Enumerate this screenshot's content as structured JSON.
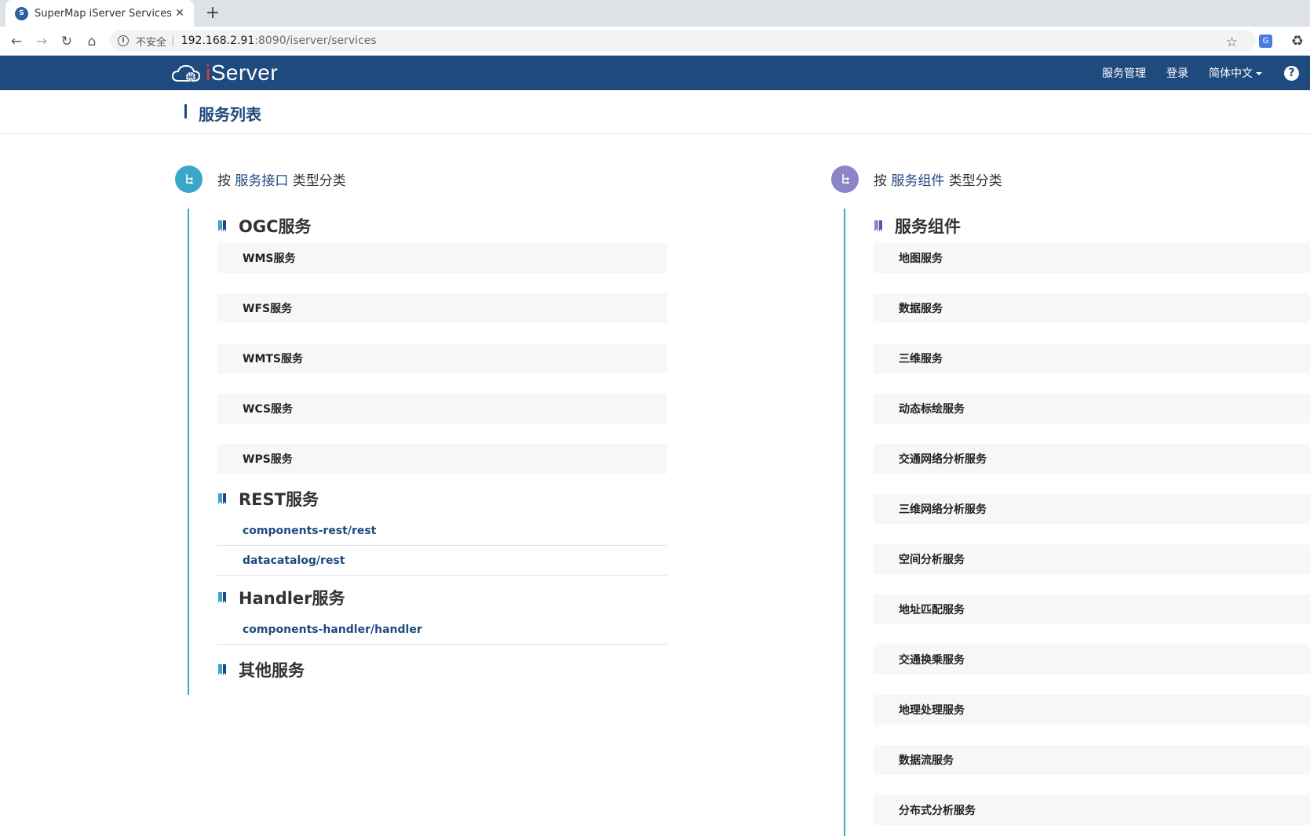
{
  "browser": {
    "tab_title": "SuperMap iServer Services",
    "close_glyph": "✕",
    "new_tab_glyph": "+",
    "insecure_label": "不安全",
    "url_host": "192.168.2.91",
    "url_rest": ":8090/iserver/services"
  },
  "header": {
    "logo_prefix": "i",
    "logo_rest": "Server",
    "nav": {
      "service_manage": "服务管理",
      "login": "登录",
      "language": "简体中文"
    },
    "help": "?"
  },
  "page_title": "服务列表",
  "left_column": {
    "heading_prefix": "按 ",
    "heading_accent": "服务接口",
    "heading_suffix": " 类型分类",
    "groups": [
      {
        "title": "OGC服务",
        "items": [
          "WMS服务",
          "WFS服务",
          "WMTS服务",
          "WCS服务",
          "WPS服务"
        ]
      },
      {
        "title": "REST服务",
        "links": [
          "components-rest/rest",
          "datacatalog/rest"
        ]
      },
      {
        "title": "Handler服务",
        "links": [
          "components-handler/handler"
        ]
      },
      {
        "title": "其他服务"
      }
    ]
  },
  "right_column": {
    "heading_prefix": "按 ",
    "heading_accent": "服务组件",
    "heading_suffix": " 类型分类",
    "group_title": "服务组件",
    "items": [
      "地图服务",
      "数据服务",
      "三维服务",
      "动态标绘服务",
      "交通网络分析服务",
      "三维网络分析服务",
      "空间分析服务",
      "地址匹配服务",
      "交通换乘服务",
      "地理处理服务",
      "数据流服务",
      "分布式分析服务"
    ]
  },
  "colors": {
    "header_bg": "#1f4a7e",
    "accent_teal": "#3aa6c9",
    "accent_purple": "#8c85c9"
  }
}
